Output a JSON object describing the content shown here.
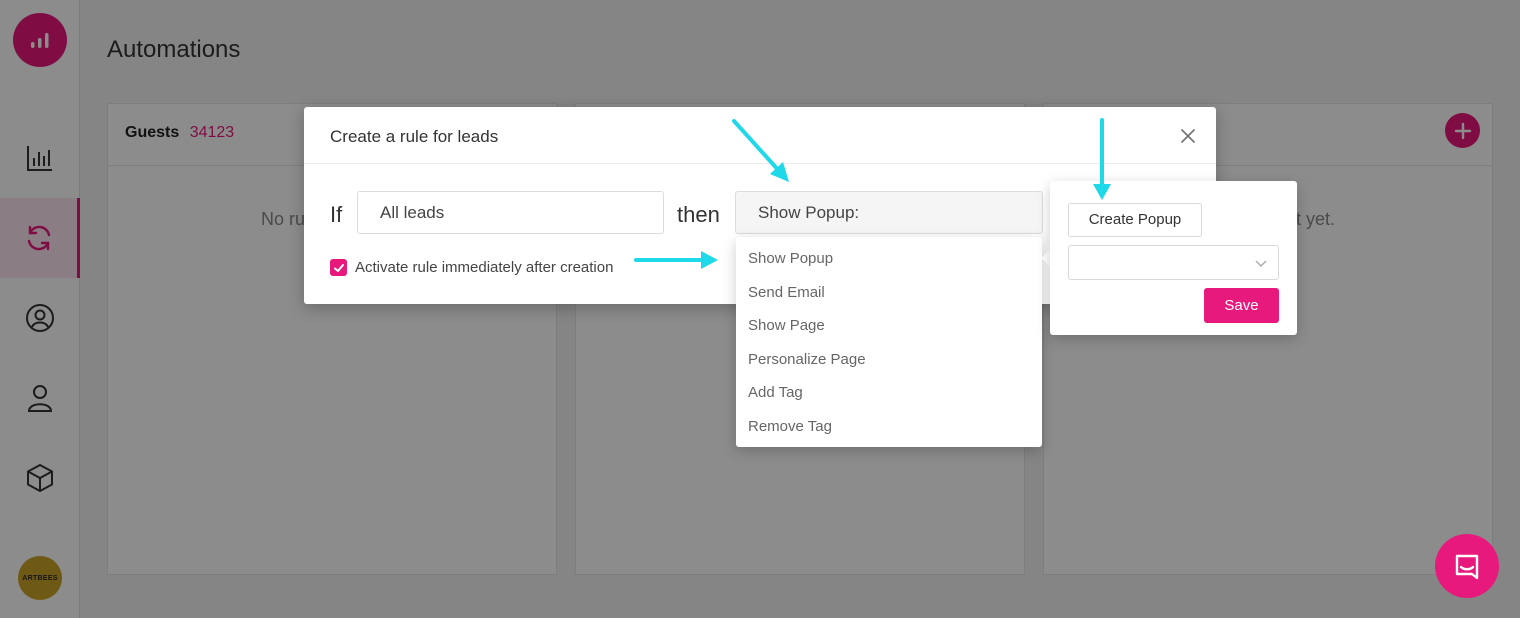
{
  "app": {
    "avatar_text": "ARTBEES",
    "colors": {
      "accent": "#e8197d",
      "arrow": "#1fd8e8"
    }
  },
  "sidebar": {
    "items": [
      {
        "icon": "bar-chart-icon",
        "active": false
      },
      {
        "icon": "sync-icon",
        "active": true
      },
      {
        "icon": "user-circle-icon",
        "active": false
      },
      {
        "icon": "user-icon",
        "active": false
      },
      {
        "icon": "cube-icon",
        "active": false
      }
    ]
  },
  "page": {
    "title": "Automations",
    "columns": [
      {
        "name": "Guests",
        "count": "34123",
        "empty_text": "No ru"
      },
      {
        "name": "",
        "count": "",
        "empty_text": ""
      },
      {
        "name": "",
        "count": "",
        "empty_text": "t yet."
      }
    ]
  },
  "modal": {
    "title": "Create a rule for leads",
    "if_label": "If",
    "if_value": "All leads",
    "then_label": "then",
    "then_value": "Show Popup:",
    "activate_label": "Activate rule immediately after creation",
    "activate_checked": true
  },
  "dropdown": {
    "options": [
      "Show Popup",
      "Send Email",
      "Show Page",
      "Personalize Page",
      "Add Tag",
      "Remove Tag"
    ]
  },
  "popover": {
    "create_label": "Create Popup",
    "select_value": "",
    "save_label": "Save"
  }
}
